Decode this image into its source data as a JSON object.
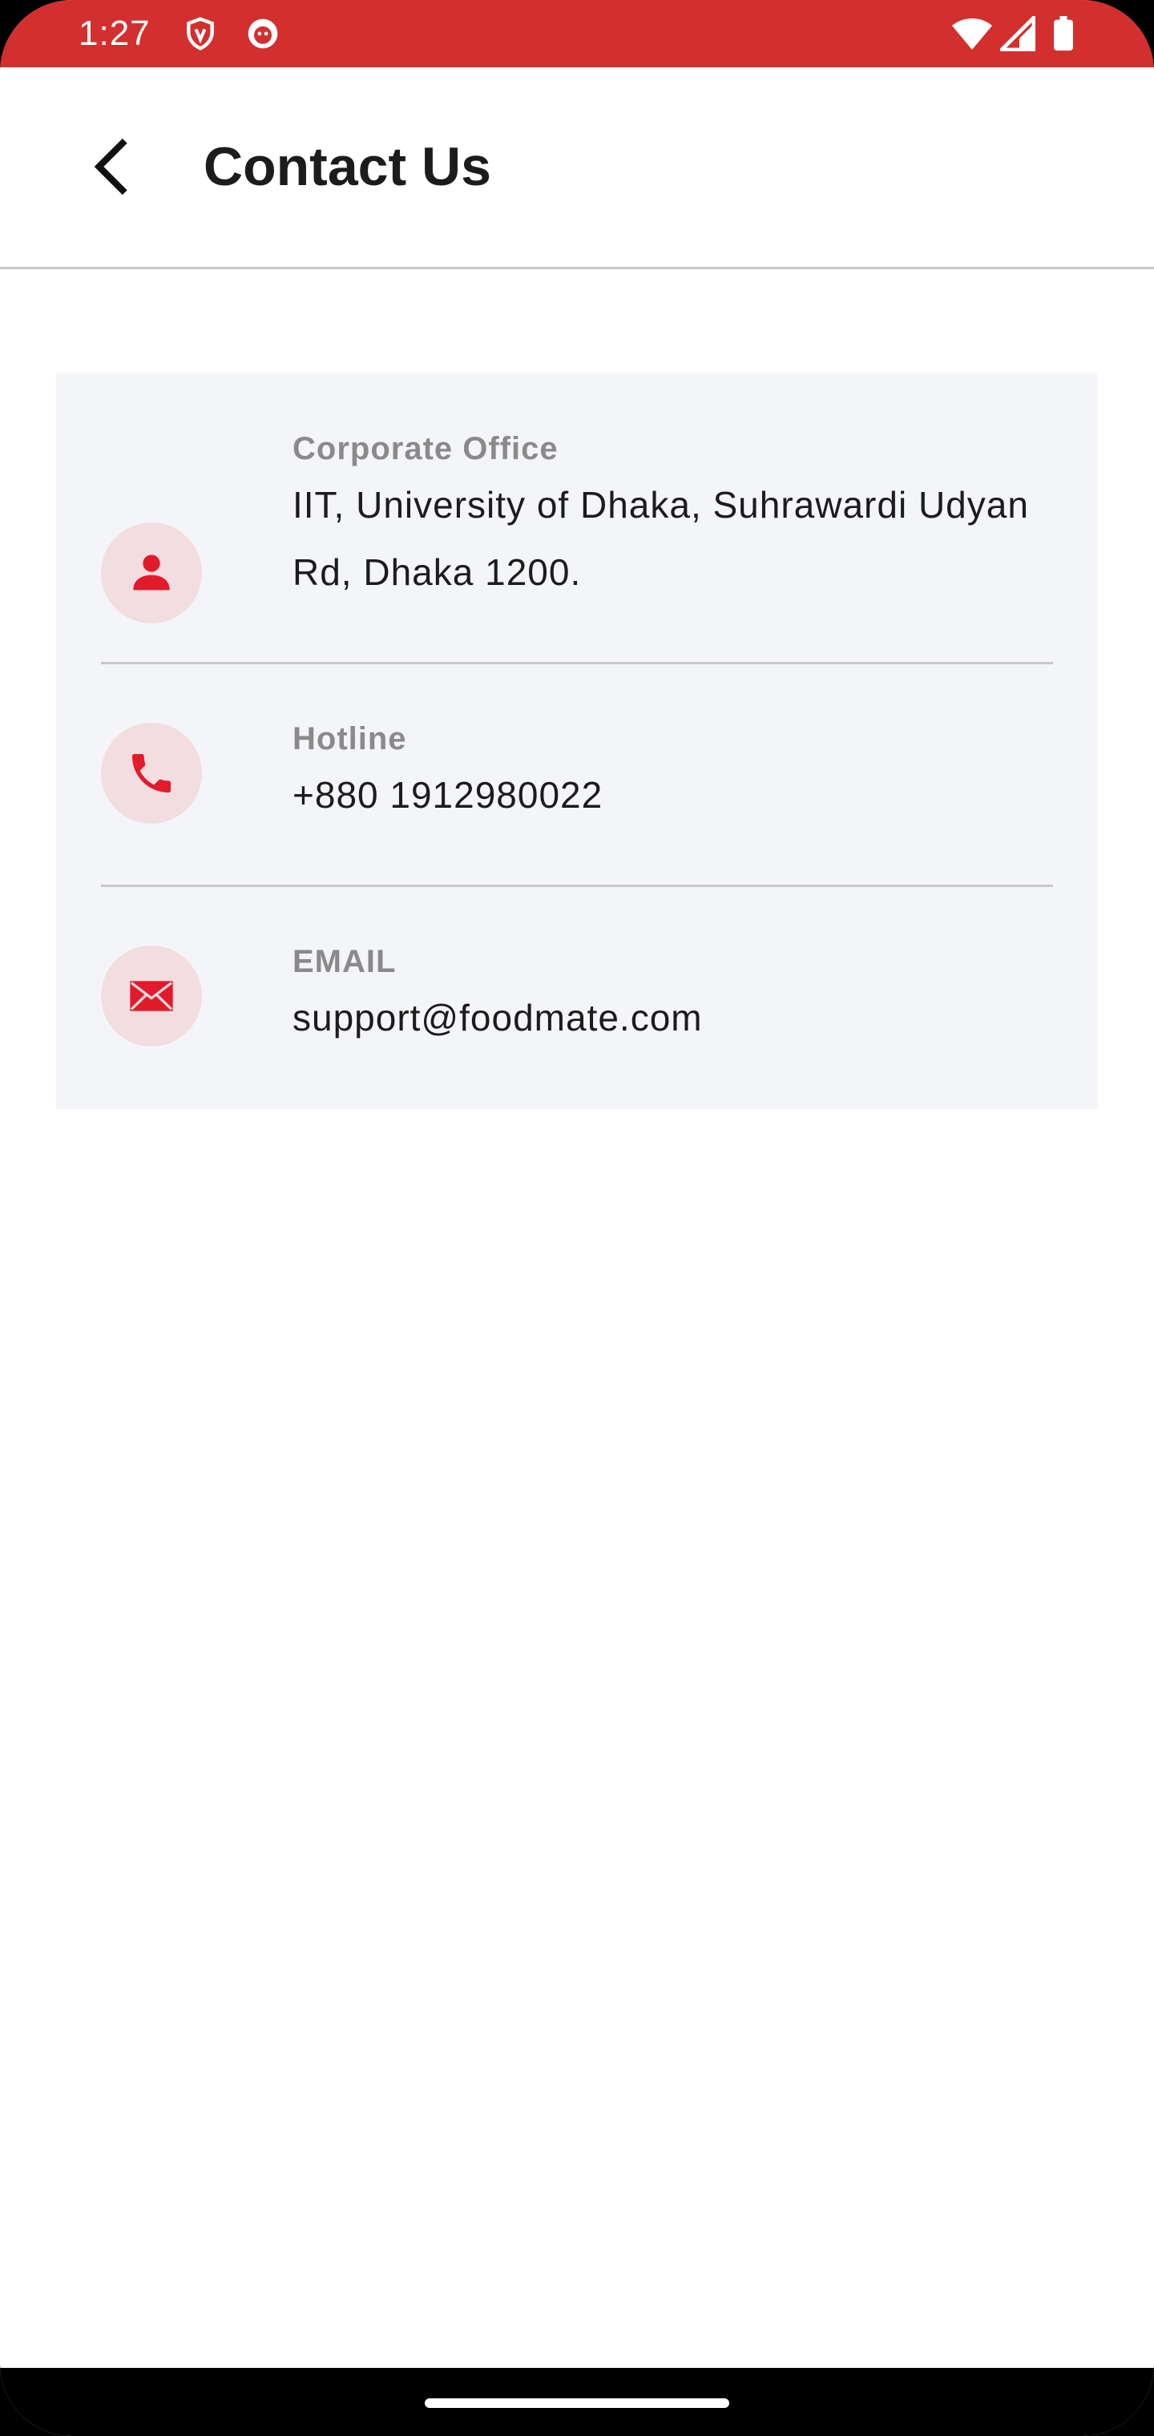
{
  "status_bar": {
    "time": "1:27",
    "background_color": "#d32f2f",
    "icons": [
      "vpn-shield-icon",
      "app-notification-icon",
      "wifi-icon",
      "cellular-signal-icon",
      "battery-icon"
    ]
  },
  "app_bar": {
    "title": "Contact Us",
    "back_icon": "chevron-left-icon"
  },
  "contacts": [
    {
      "label": "Corporate Office",
      "value": "IIT, University of Dhaka, Suhrawardi Udyan Rd, Dhaka 1200.",
      "icon": "person-icon"
    },
    {
      "label": "Hotline",
      "value": "+880 1912980022",
      "icon": "phone-icon"
    },
    {
      "label": "EMAIL",
      "value": "support@foodmate.com",
      "icon": "mail-icon"
    }
  ],
  "colors": {
    "accent": "#e21b2b",
    "icon_circle": "#f2dde1",
    "card_background": "#f4f5f9",
    "label_text": "#8a8a8a",
    "value_text": "#1c1c1c"
  }
}
